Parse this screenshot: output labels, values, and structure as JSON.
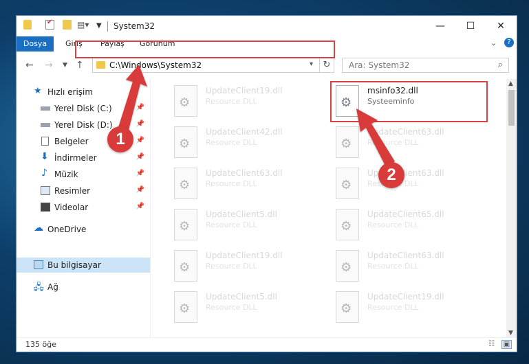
{
  "window": {
    "title": "System32",
    "controls": {
      "minimize": "—",
      "maximize": "☐",
      "close": "✕"
    }
  },
  "ribbon": {
    "tabs": [
      {
        "label": "Dosya"
      },
      {
        "label": "Giriş"
      },
      {
        "label": "Paylaş"
      },
      {
        "label": "Görünüm"
      }
    ],
    "collapse_glyph": "⌄",
    "help_glyph": "?"
  },
  "navigation": {
    "address": "C:\\Windows\\System32",
    "search_placeholder": "Ara: System32"
  },
  "sidebar": {
    "quick_access": "Hızlı erişim",
    "items": [
      {
        "label": "Yerel Disk (C:)",
        "pinned": true
      },
      {
        "label": "Yerel Disk (D:)",
        "pinned": true
      },
      {
        "label": "Belgeler",
        "pinned": true
      },
      {
        "label": "İndirmeler",
        "pinned": true
      },
      {
        "label": "Müzik",
        "pinned": true
      },
      {
        "label": "Resimler",
        "pinned": true
      },
      {
        "label": "Videolar",
        "pinned": true
      }
    ],
    "onedrive": "OneDrive",
    "this_pc": "Bu bilgisayar",
    "network": "Ağ"
  },
  "files": {
    "left_column": [
      {
        "name": "UpdateClient19.dll",
        "type": "Resource DLL"
      },
      {
        "name": "UpdateClient42.dll",
        "type": "Resource DLL"
      },
      {
        "name": "UpdateClient63.dll",
        "type": "Resource DLL"
      },
      {
        "name": "UpdateClient5.dll",
        "type": "Resource DLL"
      },
      {
        "name": "UpdateClient19.dll",
        "type": "Resource DLL"
      },
      {
        "name": "UpdateClient5.dll",
        "type": "Resource DLL"
      }
    ],
    "right_column": [
      {
        "name": "msinfo32.dll",
        "type": "Systeeminfo",
        "highlighted": true
      },
      {
        "name": "UpdateClient63.dll",
        "type": "Resource DLL"
      },
      {
        "name": "UpdateClient63.dll",
        "type": "Resource DLL"
      },
      {
        "name": "UpdateClient65.dll",
        "type": "Resource DLL"
      },
      {
        "name": "UpdateClient63.dll",
        "type": "Resource DLL"
      },
      {
        "name": "UpdateClient19.dll",
        "type": "Resource DLL"
      }
    ]
  },
  "status": {
    "item_count": "135 öğe"
  },
  "annotations": {
    "step1": "1",
    "step2": "2",
    "color": "#d93b3b"
  }
}
